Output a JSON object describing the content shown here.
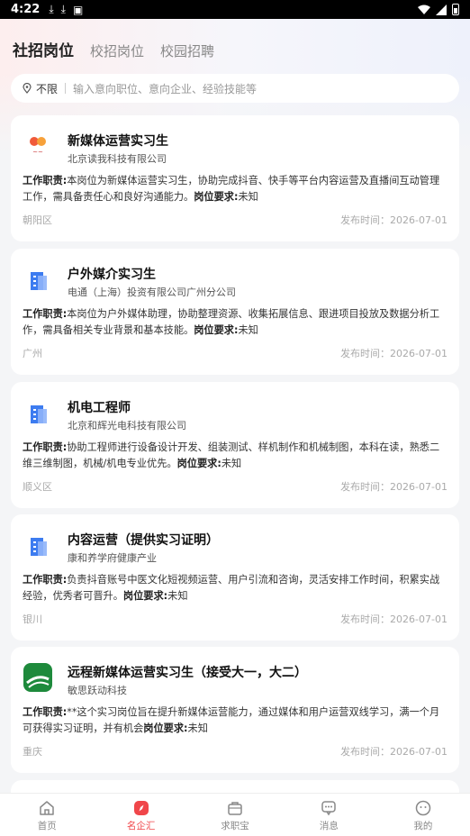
{
  "status_bar": {
    "time": "4:22"
  },
  "tabs": [
    {
      "label": "社招岗位",
      "active": true
    },
    {
      "label": "校招岗位",
      "active": false
    },
    {
      "label": "校园招聘",
      "active": false
    }
  ],
  "search": {
    "location": "不限",
    "placeholder": "输入意向职位、意向企业、经验技能等"
  },
  "jobs": [
    {
      "title": "新媒体运营实习生",
      "company": "北京读我科技有限公司",
      "duty_label": "工作职责:",
      "description": "本岗位为新媒体运营实习生，协助完成抖音、快手等平台内容运营及直播间互动管理工作，需具备责任心和良好沟通能力。",
      "req_label": "岗位要求:",
      "requirement": "未知",
      "location": "朝阳区",
      "date": "发布时间：2026-07-01",
      "logo": "duwo-logo-icon"
    },
    {
      "title": "户外媒介实习生",
      "company": "电通（上海）投资有限公司广州分公司",
      "duty_label": "工作职责:",
      "description": "本岗位为户外媒体助理，协助整理资源、收集拓展信息、跟进项目投放及数据分析工作，需具备相关专业背景和基本技能。",
      "req_label": "岗位要求:",
      "requirement": "未知",
      "location": "广州",
      "date": "发布时间：2026-07-01",
      "logo": "building-icon"
    },
    {
      "title": "机电工程师",
      "company": "北京和辉光电科技有限公司",
      "duty_label": "工作职责:",
      "description": "协助工程师进行设备设计开发、组装测试、样机制作和机械制图，本科在读，熟悉二维三维制图，机械/机电专业优先。",
      "req_label": "岗位要求:",
      "requirement": "未知",
      "location": "顺义区",
      "date": "发布时间：2026-07-01",
      "logo": "building-icon"
    },
    {
      "title": "内容运营（提供实习证明）",
      "company": "康和养学府健康产业",
      "duty_label": "工作职责:",
      "description": "负责抖音账号中医文化短视频运营、用户引流和咨询，灵活安排工作时间，积累实战经验，优秀者可晋升。",
      "req_label": "岗位要求:",
      "requirement": "未知",
      "location": "银川",
      "date": "发布时间：2026-07-01",
      "logo": "building-icon"
    },
    {
      "title": "远程新媒体运营实习生（接受大一，大二）",
      "company": "敏思跃动科技",
      "duty_label": "工作职责:",
      "description": "**这个实习岗位旨在提升新媒体运营能力，通过媒体和用户运营双线学习，满一个月可获得实习证明，并有机会",
      "req_label": "岗位要求:",
      "requirement": "未知",
      "location": "重庆",
      "date": "发布时间：2026-07-01",
      "logo": "green-road-logo-icon"
    }
  ],
  "bottom_nav": [
    {
      "label": "首页",
      "icon": "home-icon",
      "active": false
    },
    {
      "label": "名企汇",
      "icon": "compass-icon",
      "active": true
    },
    {
      "label": "求职宝",
      "icon": "briefcase-icon",
      "active": false
    },
    {
      "label": "消息",
      "icon": "message-icon",
      "active": false
    },
    {
      "label": "我的",
      "icon": "profile-icon",
      "active": false
    }
  ],
  "colors": {
    "accent": "#f0464a",
    "background": "#f4f5f7"
  }
}
